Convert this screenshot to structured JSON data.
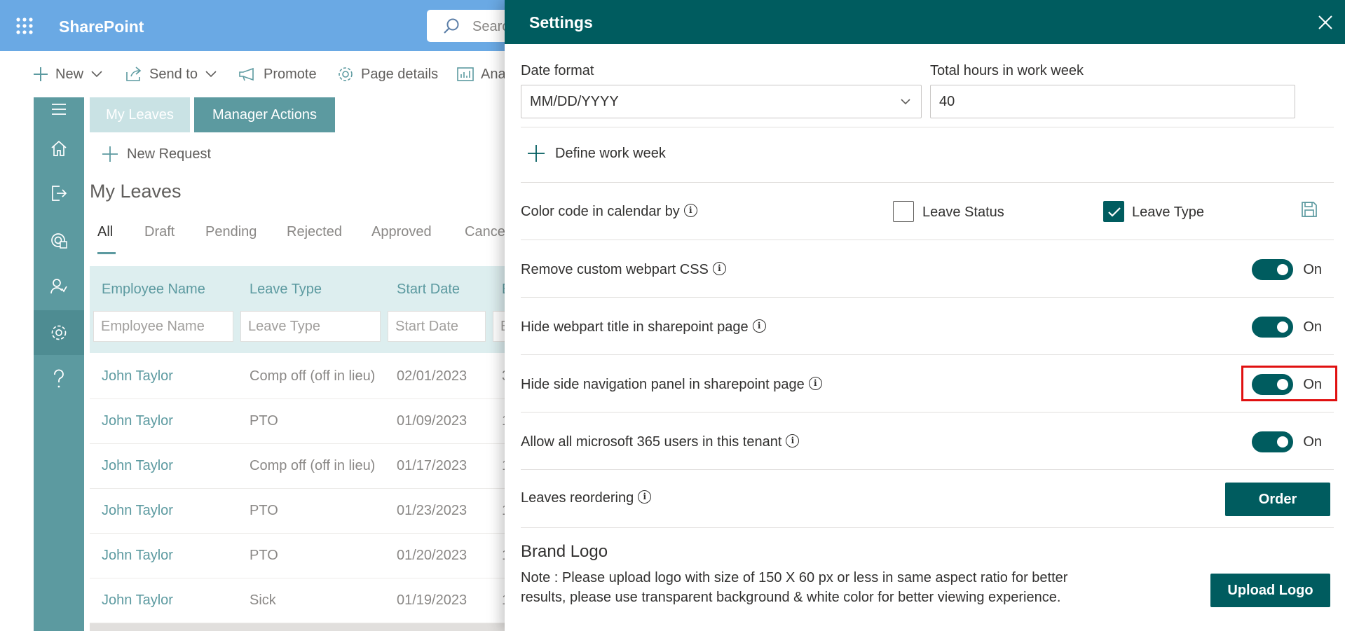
{
  "suite": {
    "brand": "SharePoint",
    "search_placeholder": "Searc"
  },
  "command_bar": {
    "new_label": "New",
    "send_to_label": "Send to",
    "promote_label": "Promote",
    "page_details_label": "Page details",
    "analytics_label": "Ana"
  },
  "app": {
    "tabs": {
      "my_leaves": "My Leaves",
      "manager_actions": "Manager Actions"
    },
    "new_request_label": "New Request",
    "section_title": "My Leaves",
    "filter_tabs": [
      "All",
      "Draft",
      "Pending",
      "Rejected",
      "Approved",
      "Cance"
    ],
    "columns": [
      {
        "header": "Employee Name",
        "filter_placeholder": "Employee Name"
      },
      {
        "header": "Leave Type",
        "filter_placeholder": "Leave Type"
      },
      {
        "header": "Start Date",
        "filter_placeholder": "Start Date"
      },
      {
        "header": "E",
        "filter_placeholder": "E"
      }
    ],
    "rows": [
      {
        "name": "John Taylor",
        "type": "Comp off (off in lieu)",
        "start": "02/01/2023",
        "more": "3"
      },
      {
        "name": "John Taylor",
        "type": "PTO",
        "start": "01/09/2023",
        "more": "1"
      },
      {
        "name": "John Taylor",
        "type": "Comp off (off in lieu)",
        "start": "01/17/2023",
        "more": "1"
      },
      {
        "name": "John Taylor",
        "type": "PTO",
        "start": "01/23/2023",
        "more": "1"
      },
      {
        "name": "John Taylor",
        "type": "PTO",
        "start": "01/20/2023",
        "more": "1"
      },
      {
        "name": "John Taylor",
        "type": "Sick",
        "start": "01/19/2023",
        "more": "1"
      }
    ]
  },
  "settings": {
    "title": "Settings",
    "date_format": {
      "label": "Date format",
      "value": "MM/DD/YYYY"
    },
    "total_hours": {
      "label": "Total hours in work week",
      "value": "40"
    },
    "define_work_week_label": "Define work week",
    "color_code": {
      "label": "Color code in calendar by",
      "leave_status_label": "Leave Status",
      "leave_status_checked": false,
      "leave_type_label": "Leave Type",
      "leave_type_checked": true
    },
    "toggles": [
      {
        "label": "Remove custom webpart CSS",
        "state": "On"
      },
      {
        "label": "Hide webpart title in sharepoint page",
        "state": "On"
      },
      {
        "label": "Hide side navigation panel in sharepoint page",
        "state": "On"
      },
      {
        "label": "Allow all microsoft 365 users in this tenant",
        "state": "On"
      }
    ],
    "reordering": {
      "label": "Leaves reordering",
      "button": "Order"
    },
    "brand_logo": {
      "title": "Brand Logo",
      "note": "Note : Please upload logo with size of 150 X 60 px or less in same aspect ratio for better results, please use transparent background & white color for better viewing experience.",
      "button": "Upload Logo"
    }
  },
  "colors": {
    "suite_bar": "#6aa9e4",
    "panel_header": "#005c5f",
    "accent": "#5c9aa0",
    "highlight": "#e01010"
  }
}
